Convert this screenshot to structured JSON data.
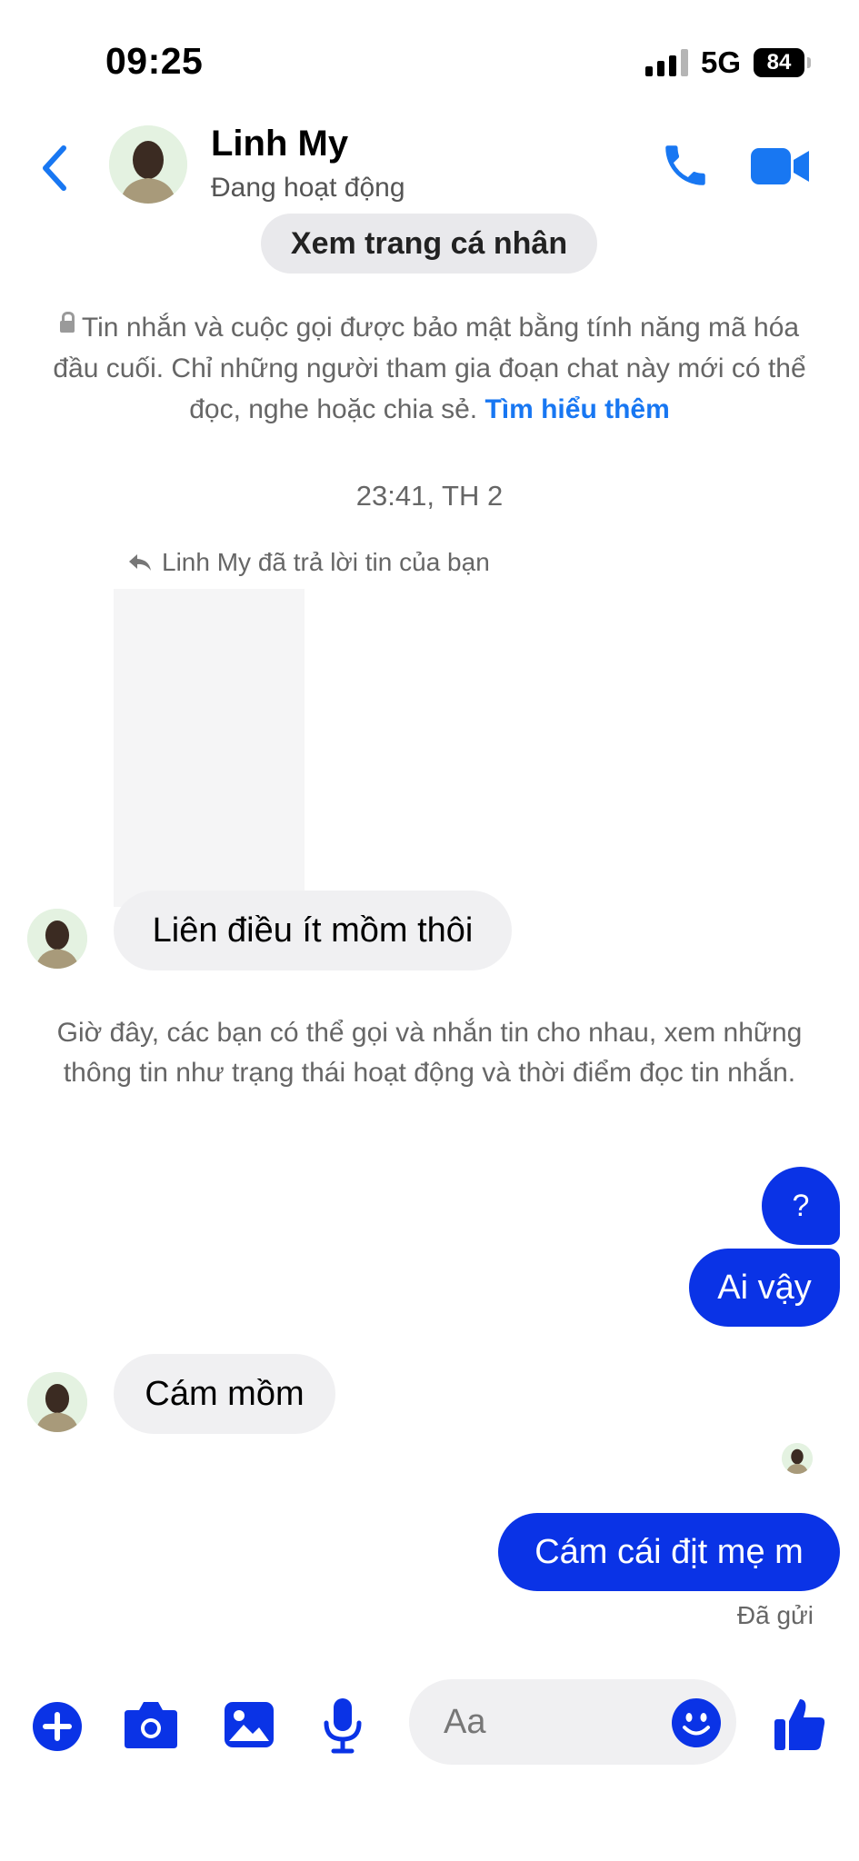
{
  "status_bar": {
    "time": "09:25",
    "network": "5G",
    "battery": "84"
  },
  "header": {
    "contact_name": "Linh My",
    "contact_status": "Đang hoạt động",
    "icons": [
      "back-chevron-icon",
      "phone-icon",
      "video-camera-icon"
    ]
  },
  "profile_button": "Xem trang cá nhân",
  "encryption_notice": {
    "text": "Tin nhắn và cuộc gọi được bảo mật bằng tính năng mã hóa đầu cuối. Chỉ những người tham gia đoạn chat này mới có thể đọc, nghe hoặc chia sẻ.",
    "link": "Tìm hiểu thêm"
  },
  "timestamp": "23:41, TH 2",
  "reply_note": "Linh My đã trả lời tin của bạn",
  "messages": [
    {
      "from": "contact",
      "text": "Liên điều ít mồm thôi"
    },
    {
      "from": "me",
      "text": "?"
    },
    {
      "from": "me",
      "text": "Ai vậy"
    },
    {
      "from": "contact",
      "text": "Cám mồm"
    },
    {
      "from": "me",
      "text": "Cám cái địt mẹ m"
    }
  ],
  "system_notice": "Giờ đây, các bạn có thể gọi và nhắn tin cho nhau, xem những thông tin như trạng thái hoạt động và thời điểm đọc tin nhắn.",
  "sent_status": "Đã gửi",
  "composer": {
    "placeholder": "Aa",
    "icons": [
      "plus-icon",
      "camera-icon",
      "photo-icon",
      "microphone-icon",
      "emoji-icon",
      "thumbs-up-icon"
    ]
  },
  "colors": {
    "accent": "#1877f2",
    "outgoing_bubble": "#0a33e6",
    "incoming_bubble": "#f0f0f2"
  }
}
